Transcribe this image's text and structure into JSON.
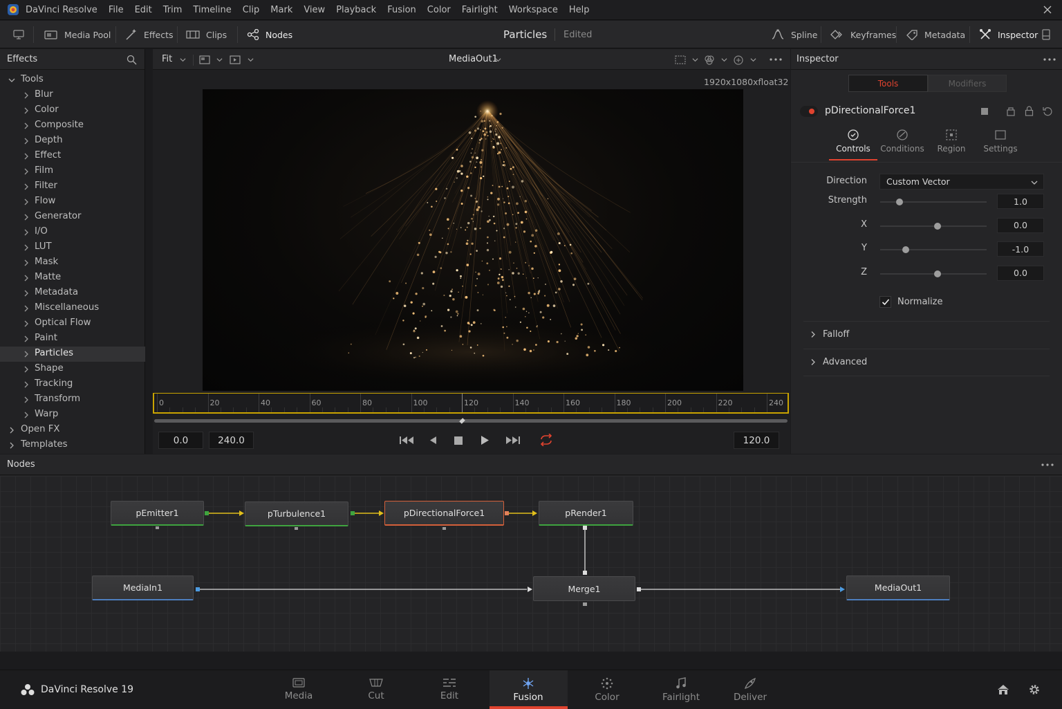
{
  "app": {
    "name": "DaVinci Resolve",
    "menu": [
      "File",
      "Edit",
      "Trim",
      "Timeline",
      "Clip",
      "Mark",
      "View",
      "Playback",
      "Fusion",
      "Color",
      "Fairlight",
      "Workspace",
      "Help"
    ]
  },
  "toolbar": {
    "media_pool": "Media Pool",
    "effects": "Effects",
    "clips": "Clips",
    "nodes": "Nodes",
    "title": "Particles",
    "status": "Edited",
    "spline": "Spline",
    "keyframes": "Keyframes",
    "metadata": "Metadata",
    "inspector": "Inspector"
  },
  "effects_panel": {
    "title": "Effects",
    "tools_label": "Tools",
    "items": [
      "Blur",
      "Color",
      "Composite",
      "Depth",
      "Effect",
      "Film",
      "Filter",
      "Flow",
      "Generator",
      "I/O",
      "LUT",
      "Mask",
      "Matte",
      "Metadata",
      "Miscellaneous",
      "Optical Flow",
      "Paint",
      "Particles",
      "Shape",
      "Tracking",
      "Transform",
      "Warp"
    ],
    "selected": "Particles",
    "open_fx": "Open FX",
    "templates": "Templates"
  },
  "viewer": {
    "zoom": "Fit",
    "output": "MediaOut1",
    "resolution": "1920x1080xfloat32",
    "ruler_ticks": [
      "0",
      "20",
      "40",
      "60",
      "80",
      "100",
      "120",
      "140",
      "160",
      "180",
      "200",
      "220",
      "240"
    ],
    "start": "0.0",
    "end": "240.0",
    "current": "120.0",
    "playhead_fraction": 0.5
  },
  "inspector": {
    "title": "Inspector",
    "seg_tools": "Tools",
    "seg_modifiers": "Modifiers",
    "node_name": "pDirectionalForce1",
    "tabs": [
      "Controls",
      "Conditions",
      "Region",
      "Settings"
    ],
    "active_tab": "Controls",
    "direction_label": "Direction",
    "direction_value": "Custom Vector",
    "params": [
      {
        "label": "Strength",
        "value": "1.0",
        "slider": 0.18
      },
      {
        "label": "X",
        "value": "0.0",
        "slider": 0.54
      },
      {
        "label": "Y",
        "value": "-1.0",
        "slider": 0.24
      },
      {
        "label": "Z",
        "value": "0.0",
        "slider": 0.54
      }
    ],
    "normalize_label": "Normalize",
    "normalize_checked": true,
    "sections": [
      "Falloff",
      "Advanced"
    ]
  },
  "nodes_panel": {
    "title": "Nodes",
    "nodes": [
      "pEmitter1",
      "pTurbulence1",
      "pDirectionalForce1",
      "pRender1",
      "MediaIn1",
      "Merge1",
      "MediaOut1"
    ]
  },
  "pagebar": {
    "product": "DaVinci Resolve 19",
    "pages": [
      "Media",
      "Cut",
      "Edit",
      "Fusion",
      "Color",
      "Fairlight",
      "Deliver"
    ],
    "active": "Fusion"
  },
  "colors": {
    "accent_red": "#e0432f",
    "timeline_yellow": "#c9a400",
    "node_green": "#3fa43f",
    "node_blue": "#4d7fbf",
    "active_node": "#d4603a"
  }
}
